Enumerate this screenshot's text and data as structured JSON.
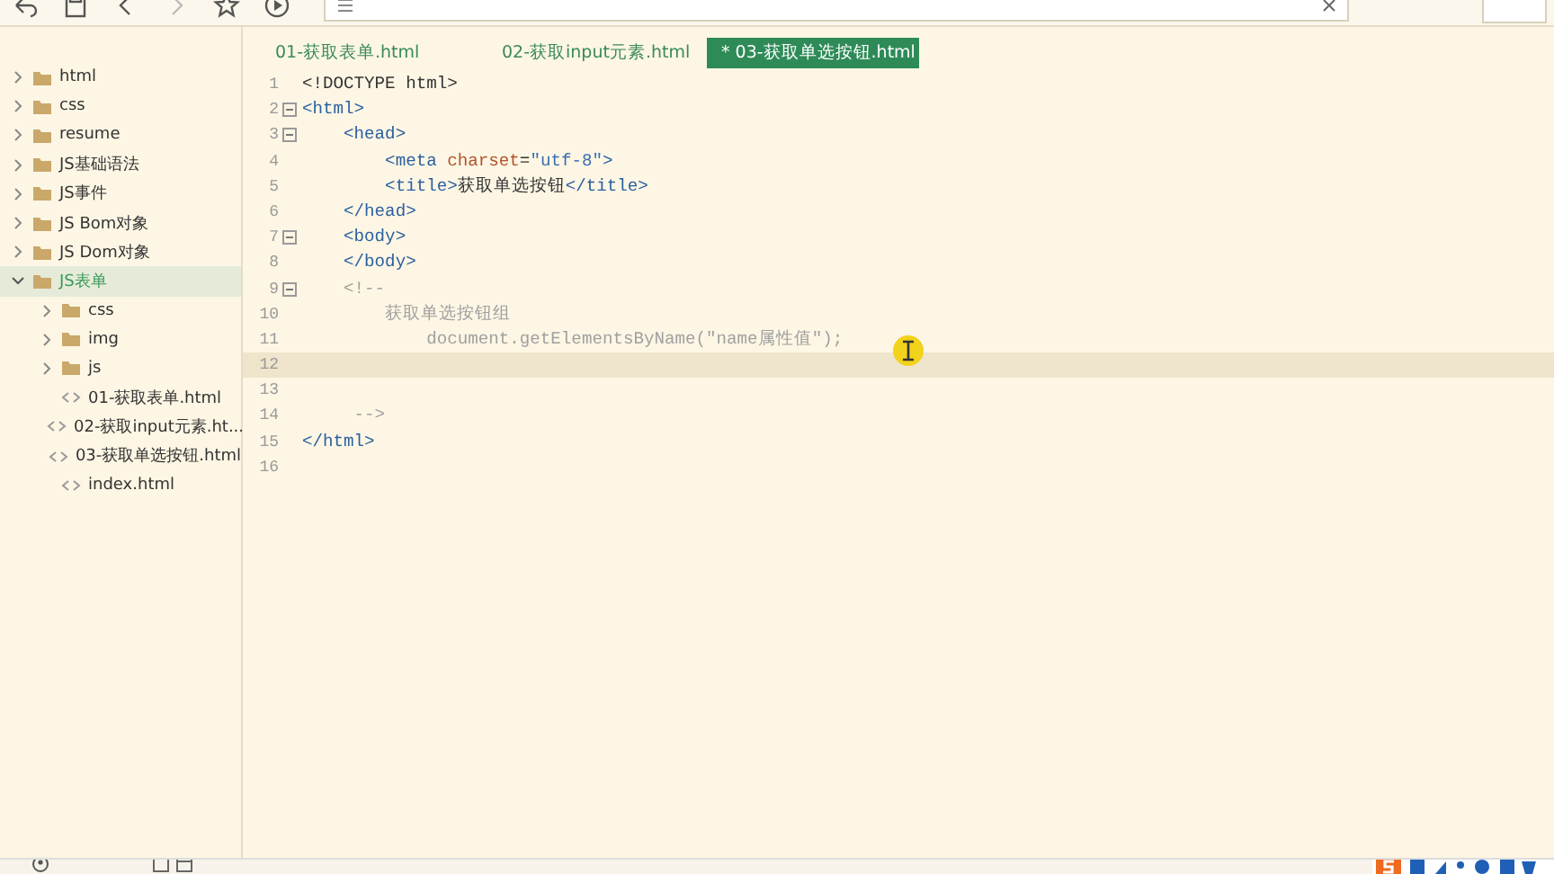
{
  "sidebar": {
    "items": [
      {
        "label": "html",
        "kind": "folder",
        "expanded": false,
        "selected": false
      },
      {
        "label": "css",
        "kind": "folder",
        "expanded": false,
        "selected": false
      },
      {
        "label": "resume",
        "kind": "folder",
        "expanded": false,
        "selected": false
      },
      {
        "label": "JS基础语法",
        "kind": "folder",
        "expanded": false,
        "selected": false
      },
      {
        "label": "JS事件",
        "kind": "folder",
        "expanded": false,
        "selected": false
      },
      {
        "label": "JS Bom对象",
        "kind": "folder",
        "expanded": false,
        "selected": false
      },
      {
        "label": "JS Dom对象",
        "kind": "folder",
        "expanded": false,
        "selected": false
      },
      {
        "label": "JS表单",
        "kind": "folder",
        "expanded": true,
        "selected": true,
        "children": [
          {
            "label": "css",
            "kind": "folder",
            "expanded": false,
            "selected": false
          },
          {
            "label": "img",
            "kind": "folder",
            "expanded": false,
            "selected": false
          },
          {
            "label": "js",
            "kind": "folder",
            "expanded": false,
            "selected": false
          },
          {
            "label": "01-获取表单.html",
            "kind": "file",
            "selected": false
          },
          {
            "label": "02-获取input元素.ht...",
            "kind": "file",
            "selected": false
          },
          {
            "label": "03-获取单选按钮.html",
            "kind": "file",
            "selected": false
          },
          {
            "label": "index.html",
            "kind": "file",
            "selected": false
          }
        ]
      }
    ]
  },
  "tabs": [
    {
      "label": "01-获取表单.html",
      "selected": false
    },
    {
      "label": "02-获取input元素.html",
      "selected": false
    },
    {
      "label": "* 03-获取单选按钮.html",
      "selected": true
    }
  ],
  "editor": {
    "lines": [
      {
        "number": "1",
        "foldable": false,
        "current": false,
        "tokens": [
          {
            "kind": "plain",
            "text": "<!DOCTYPE html>"
          }
        ]
      },
      {
        "number": "2",
        "foldable": true,
        "current": false,
        "tokens": [
          {
            "kind": "tag",
            "text": "<html>"
          }
        ]
      },
      {
        "number": "3",
        "foldable": true,
        "current": false,
        "tokens": [
          {
            "kind": "tag",
            "text": "    <head>"
          }
        ]
      },
      {
        "number": "4",
        "foldable": false,
        "current": false,
        "tokens": [
          {
            "kind": "tag",
            "text": "        <meta "
          },
          {
            "kind": "attr",
            "text": "charset"
          },
          {
            "kind": "plain",
            "text": "="
          },
          {
            "kind": "string",
            "text": "\"utf-8\""
          },
          {
            "kind": "tag",
            "text": ">"
          }
        ]
      },
      {
        "number": "5",
        "foldable": false,
        "current": false,
        "tokens": [
          {
            "kind": "tag",
            "text": "        <title>"
          },
          {
            "kind": "plain",
            "text": "获取单选按钮"
          },
          {
            "kind": "tag",
            "text": "</title>"
          }
        ]
      },
      {
        "number": "6",
        "foldable": false,
        "current": false,
        "tokens": [
          {
            "kind": "tag",
            "text": "    </head>"
          }
        ]
      },
      {
        "number": "7",
        "foldable": true,
        "current": false,
        "tokens": [
          {
            "kind": "tag",
            "text": "    <body>"
          }
        ]
      },
      {
        "number": "8",
        "foldable": false,
        "current": false,
        "tokens": [
          {
            "kind": "tag",
            "text": "    </body>"
          }
        ]
      },
      {
        "number": "9",
        "foldable": true,
        "current": false,
        "tokens": [
          {
            "kind": "comment",
            "text": "    <!--"
          }
        ]
      },
      {
        "number": "10",
        "foldable": false,
        "current": false,
        "tokens": [
          {
            "kind": "comment",
            "text": "        获取单选按钮组"
          }
        ]
      },
      {
        "number": "11",
        "foldable": false,
        "current": false,
        "tokens": [
          {
            "kind": "comment",
            "text": "            document.getElementsByName(\"name属性值\");"
          }
        ]
      },
      {
        "number": "12",
        "foldable": false,
        "current": true
      },
      {
        "number": "13",
        "foldable": false,
        "current": false
      },
      {
        "number": "14",
        "foldable": false,
        "current": false,
        "tokens": [
          {
            "kind": "comment",
            "text": "     -->"
          }
        ]
      },
      {
        "number": "15",
        "foldable": false,
        "current": false,
        "tokens": [
          {
            "kind": "tag",
            "text": "</html>"
          }
        ]
      },
      {
        "number": "16",
        "foldable": false,
        "current": false
      }
    ]
  }
}
